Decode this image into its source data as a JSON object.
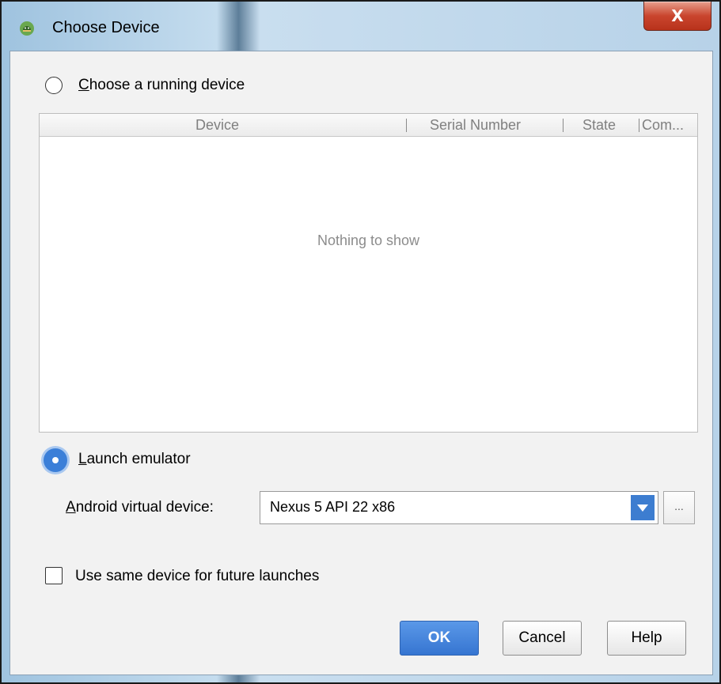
{
  "window": {
    "title": "Choose Device",
    "close_glyph": "X",
    "app_icon": "android-icon"
  },
  "running": {
    "label": "Choose a running device",
    "accel": "C",
    "label_rest": "hoose a running device",
    "selected": false
  },
  "table": {
    "columns": [
      "Device",
      "Serial Number",
      "State",
      "Com..."
    ],
    "empty_text": "Nothing to show",
    "rows": []
  },
  "emulator": {
    "label": "Launch emulator",
    "accel": "L",
    "label_rest": "aunch emulator",
    "selected": true
  },
  "avd": {
    "label": "Android virtual device:",
    "accel": "A",
    "label_rest": "ndroid virtual device:",
    "selected_value": "Nexus 5 API 22 x86",
    "more_label": "..."
  },
  "future": {
    "label": "Use same device for future launches",
    "checked": false
  },
  "buttons": {
    "ok": "OK",
    "cancel": "Cancel",
    "help": "Help"
  },
  "colors": {
    "accent": "#3b7fd8",
    "close": "#c9452e"
  }
}
